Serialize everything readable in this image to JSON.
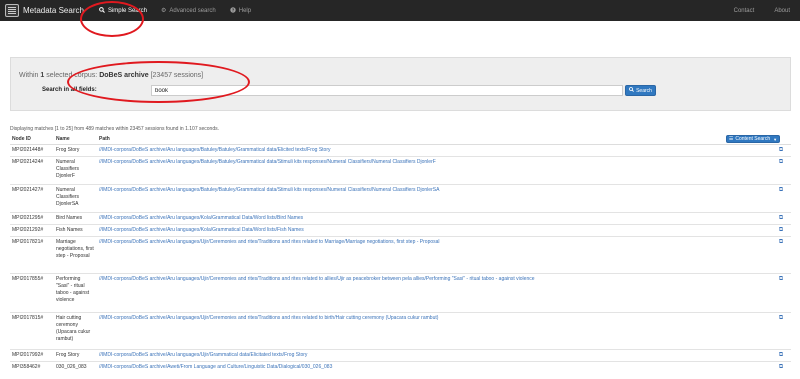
{
  "nav": {
    "brand": "Metadata Search",
    "items": [
      {
        "label": "Simple Search",
        "icon": "search-icon",
        "active": true
      },
      {
        "label": "Advanced search",
        "icon": "gear-icon",
        "active": false
      },
      {
        "label": "Help",
        "icon": "question-icon",
        "active": false
      }
    ],
    "right": [
      {
        "label": "Contact"
      },
      {
        "label": "About"
      }
    ]
  },
  "search": {
    "within_prefix": "Within",
    "count": "1",
    "within_middle": "selected corpus:",
    "corpus": "DoBeS archive",
    "sessions": "[23457 sessions]",
    "label": "Search in all fields:",
    "value": "book",
    "button": "Search"
  },
  "summary": "Displaying matches [1 to 25] from 489 matches within 23457 sessions found in 1.107 seconds.",
  "content_search_button": "Content Search",
  "table": {
    "headers": [
      "Node ID",
      "Name",
      "Path"
    ],
    "rows": [
      {
        "id": "MPI2021448#",
        "name": "Frog Story",
        "path": "//IMDI-corpora/DoBeS archive/Aru languages/Batuley/Batuley/Grammatical data/Elicited texts/Frog Story"
      },
      {
        "id": "MPI2021424#",
        "name": "Numeral Classifiers DjonlerF",
        "path": "//IMDI-corpora/DoBeS archive/Aru languages/Batuley/Batuley/Grammatical data/Stimuli kits responses/Numeral Classifiers/Numeral Classifiers DjonlerF"
      },
      {
        "id": "MPI2021427#",
        "name": "Numeral Classifiers DjonlerSA",
        "path": "//IMDI-corpora/DoBeS archive/Aru languages/Batuley/Batuley/Grammatical data/Stimuli kits responses/Numeral Classifiers/Numeral Classifiers DjonlerSA"
      },
      {
        "id": "MPI2021295#",
        "name": "Bird Names",
        "path": "//IMDI-corpora/DoBeS archive/Aru languages/Kola/Grammatical Data/Word lists/Bird Names"
      },
      {
        "id": "MPI2021292#",
        "name": "Fish Names",
        "path": "//IMDI-corpora/DoBeS archive/Aru languages/Kola/Grammatical Data/Word lists/Fish Names"
      },
      {
        "id": "MPI2017821#",
        "name": "Marriage negotiations, first step - Proposal",
        "path": "//IMDI-corpora/DoBeS archive/Aru languages/Ujir/Ceremonies and rites/Traditions and rites related to Marriage/Marriage negotiations, first step - Proposal"
      },
      {
        "id": "MPI2017855#",
        "name": "Performing \"Sasi\" - ritual taboo - against violence",
        "path": "//IMDI-corpora/DoBeS archive/Aru languages/Ujir/Ceremonies and rites/Traditions and rites related to allies/Ujir as peacebroker between pela allies/Performing \"Sasi\" - ritual taboo - against violence"
      },
      {
        "id": "MPI2017815#",
        "name": "Hair cutting ceremony (Upacara cukur rambut)",
        "path": "//IMDI-corpora/DoBeS archive/Aru languages/Ujir/Ceremonies and rites/Traditions and rites related to birth/Hair cutting ceremony (Upacara cukur rambut)"
      },
      {
        "id": "MPI2017992#",
        "name": "Frog Story",
        "path": "//IMDI-corpora/DoBeS archive/Aru languages/Ujir/Grammatical data/Elicitated texts/Frog Story"
      },
      {
        "id": "MPI358462#",
        "name": "030_026_083",
        "path": "//IMDI-corpora/DoBeS archive/Aweti/From Language and Culture/Linguistic Data/Dialogical/030_026_083"
      }
    ]
  },
  "colors": {
    "navbar": "#262626",
    "accent_blue": "#3078c0",
    "link": "#3b73b9",
    "annotation_red": "#e0191f"
  }
}
